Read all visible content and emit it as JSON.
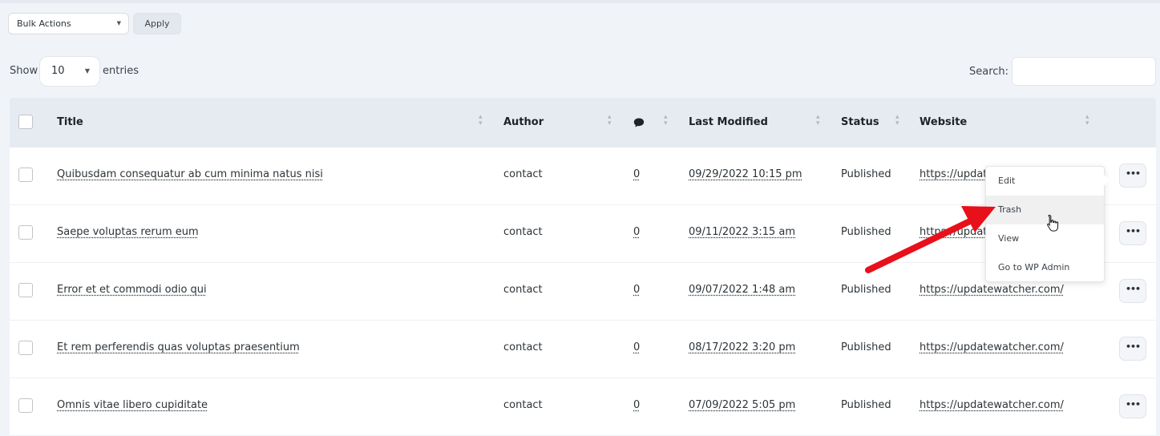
{
  "toolbar": {
    "bulk_actions": "Bulk Actions",
    "apply": "Apply"
  },
  "length_control": {
    "show": "Show",
    "value": "10",
    "entries": "entries"
  },
  "search": {
    "label": "Search:",
    "value": ""
  },
  "table": {
    "columns": {
      "title": "Title",
      "author": "Author",
      "comments_icon": "comment-icon",
      "last_modified": "Last Modified",
      "status": "Status",
      "website": "Website"
    },
    "rows": [
      {
        "title": "Quibusdam consequatur ab cum minima natus nisi",
        "author": "contact",
        "comments": "0",
        "modified": "09/29/2022 10:15 pm",
        "status": "Published",
        "website": "https://updat"
      },
      {
        "title": "Saepe voluptas rerum eum",
        "author": "contact",
        "comments": "0",
        "modified": "09/11/2022 3:15 am",
        "status": "Published",
        "website": "https://updat"
      },
      {
        "title": "Error et et commodi odio qui",
        "author": "contact",
        "comments": "0",
        "modified": "09/07/2022 1:48 am",
        "status": "Published",
        "website": "https://updatewatcher.com/"
      },
      {
        "title": "Et rem perferendis quas voluptas praesentium",
        "author": "contact",
        "comments": "0",
        "modified": "08/17/2022 3:20 pm",
        "status": "Published",
        "website": "https://updatewatcher.com/"
      },
      {
        "title": "Omnis vitae libero cupiditate",
        "author": "contact",
        "comments": "0",
        "modified": "07/09/2022 5:05 pm",
        "status": "Published",
        "website": "https://updatewatcher.com/"
      }
    ],
    "more_label": "•••"
  },
  "row_menu": {
    "items": [
      "Edit",
      "Trash",
      "View",
      "Go to WP Admin"
    ],
    "highlighted": "Trash"
  },
  "annotation": {
    "arrow_color": "#e8101a"
  }
}
